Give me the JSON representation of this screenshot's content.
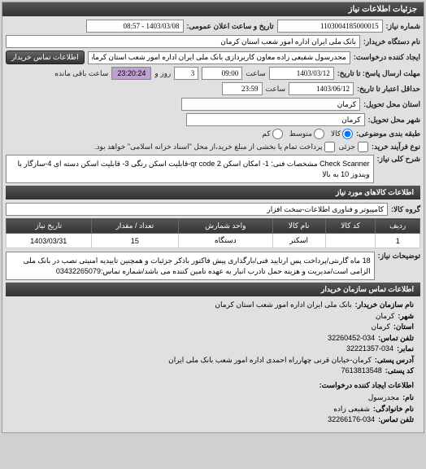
{
  "panel_title": "جزئیات اطلاعات نیاز",
  "fields": {
    "need_number_label": "شماره نیاز:",
    "need_number": "1103004185000015",
    "announce_date_label": "تاریخ و ساعت اعلان عمومی:",
    "announce_date": "1403/03/08 - 08:57",
    "buyer_org_label": "نام دستگاه خریدار:",
    "buyer_org": "بانک ملی ایران اداره امور شعب استان کرمان",
    "requester_label": "ایجاد کننده درخواست:",
    "requester": "مجدرسول شفیعی زاده معاون کاربردازی بانک ملی ایران اداره امور شعب استان کرمان",
    "buyer_contact_btn": "اطلاعات تماس خریدار",
    "deadline_label": "مهلت ارسال پاسخ: تا تاریخ:",
    "deadline_date": "1403/03/12",
    "deadline_time_label": "ساعت",
    "deadline_time": "09:00",
    "days_label": "روز و",
    "days": "3",
    "remain_time": "23:20:24",
    "remain_label": "ساعت باقی مانده",
    "validity_label": "حداقل اعتبار تا تاریخ:",
    "validity_date": "1403/06/12",
    "validity_time_label": "ساعت",
    "validity_time": "23:59",
    "delivery_province_label": "استان محل تحویل:",
    "delivery_province": "کرمان",
    "delivery_city_label": "شهر محل تحویل:",
    "delivery_city": "کرمان",
    "budget_type_label": "طبقه بندی موضوعی:",
    "budget_all": "کالا",
    "budget_mid": "متوسط",
    "budget_low": "کم",
    "process_type_label": "نوع فرآیند خرید:",
    "process_partial": "جزئی",
    "process_full": "پرداخت تمام یا بخشی از مبلغ خرید،از محل \"اسناد خزانه اسلامی\" خواهد بود.",
    "desc_label": "شرح کلی نیاز:",
    "desc": "Check Scanner مشخصات فنی: 1- امکان اسکن qr code 2-قابلیت اسکن رنگی 3- قابلیت اسکن دسته ای 4-سازگار با ویندوز 10 به بالا",
    "goods_header": "اطلاعات کالاهای مورد نیاز",
    "goods_group_label": "گروه کالا:",
    "goods_group": "کامپیوتر و فناوری اطلاعات-سخت افزار",
    "notes_label": "توضیحات نیاز:",
    "notes": "18 ماه گارنتی/پرداخت پس ارتایید فنی/بارگذاری پیش فاکتور باذکر جزئیات و همچنین تاییدیه امنیتی نصب در بانک ملی الزامی است/مدیریت و هزینه حمل تادرب انبار به عهده تامین کننده می باشد/شماره تماس:03432265079"
  },
  "table": {
    "headers": [
      "ردیف",
      "کد کالا",
      "نام کالا",
      "واحد شمارش",
      "تعداد / مقدار",
      "تاریخ نیاز"
    ],
    "rows": [
      [
        "1",
        "",
        "اسکنر",
        "دستگاه",
        "15",
        "1403/03/31"
      ]
    ]
  },
  "contact": {
    "header": "اطلاعات تماس سازمان خریدار",
    "org_label": "نام سازمان خریدار:",
    "org": "بانک ملی ایران اداره امور شعب استان کرمان",
    "city_label": "شهر:",
    "city": "کرمان",
    "province_label": "استان:",
    "province": "کرمان",
    "phone_label": "تلفن تماس:",
    "phone": "32260452-034",
    "fax_label": "نمابر:",
    "fax": "32221357-034",
    "address_label": "آدرس پستی:",
    "address": "کرمان-خیابان قرنی چهارراه احمدی اداره امور شعب بانک ملی ایران",
    "postal_label": "کد پستی:",
    "postal": "7613813548",
    "creator_header": "اطلاعات ایجاد کننده درخواست:",
    "name_label": "نام:",
    "name": "مجدرسول",
    "surname_label": "نام خانوادگی:",
    "surname": "شفیعی زاده",
    "creator_phone_label": "تلفن تماس:",
    "creator_phone": "32266176-034"
  }
}
